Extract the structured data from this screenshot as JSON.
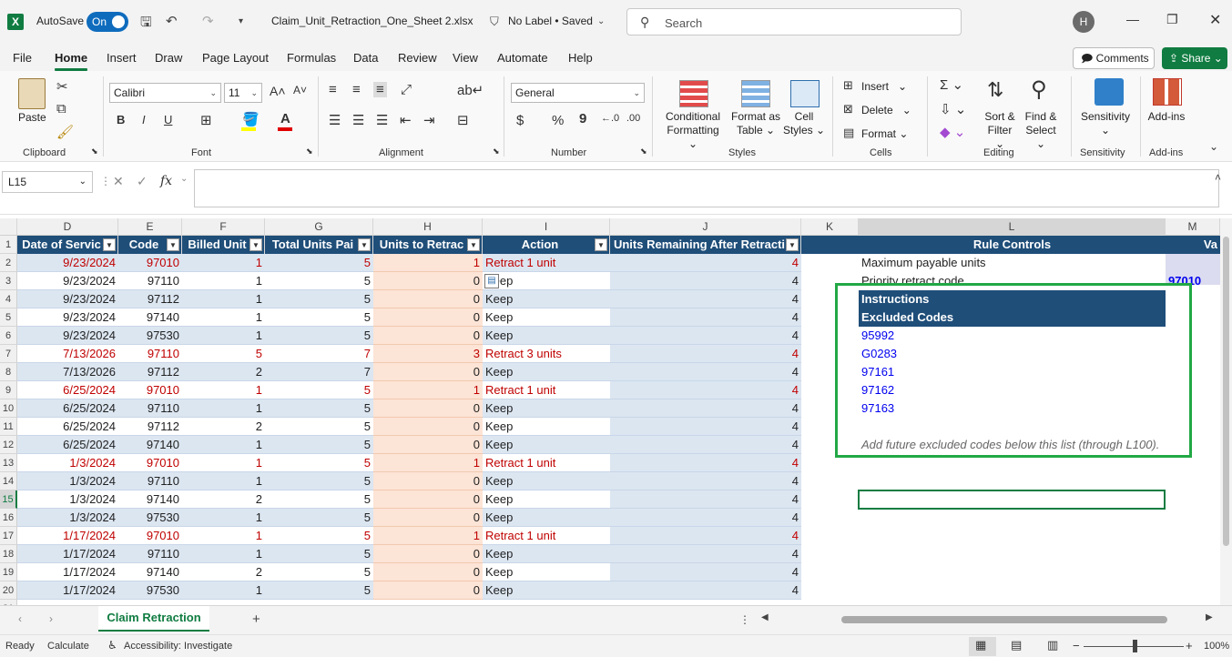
{
  "titlebar": {
    "autosave_label": "AutoSave",
    "autosave_state": "On",
    "filename": "Claim_Unit_Retraction_One_Sheet 2.xlsx",
    "label_status": "No Label • Saved",
    "search_placeholder": "Search",
    "user_initial": "H"
  },
  "menu": {
    "items": [
      "File",
      "Home",
      "Insert",
      "Draw",
      "Page Layout",
      "Formulas",
      "Data",
      "Review",
      "View",
      "Automate",
      "Help"
    ],
    "active": "Home",
    "comments": "Comments",
    "share": "Share"
  },
  "ribbon": {
    "clipboard": {
      "paste": "Paste",
      "label": "Clipboard"
    },
    "font": {
      "name": "Calibri",
      "size": "11",
      "label": "Font",
      "bold": "B",
      "italic": "I",
      "underline": "U"
    },
    "alignment": {
      "label": "Alignment"
    },
    "number": {
      "format": "General",
      "label": "Number",
      "currency": "$",
      "percent": "%",
      "comma": "9"
    },
    "styles": {
      "conditional": "Conditional",
      "formatting": "Formatting",
      "format_as": "Format as",
      "table": "Table",
      "cell": "Cell",
      "cell_styles": "Styles",
      "label": "Styles"
    },
    "cells": {
      "insert": "Insert",
      "delete": "Delete",
      "format": "Format",
      "label": "Cells"
    },
    "editing": {
      "sort": "Sort &",
      "filter": "Filter",
      "find": "Find &",
      "select": "Select",
      "label": "Editing"
    },
    "sensitivity": {
      "btn": "Sensitivity",
      "label": "Sensitivity"
    },
    "addins": {
      "btn": "Add-ins",
      "label": "Add-ins"
    }
  },
  "formula": {
    "namebox": "L15",
    "fx": "fx"
  },
  "grid": {
    "columns": [
      {
        "letter": "D",
        "width": 111
      },
      {
        "letter": "E",
        "width": 70
      },
      {
        "letter": "F",
        "width": 91
      },
      {
        "letter": "G",
        "width": 119
      },
      {
        "letter": "H",
        "width": 120
      },
      {
        "letter": "I",
        "width": 140
      },
      {
        "letter": "J",
        "width": 210
      },
      {
        "letter": "K",
        "width": 63
      },
      {
        "letter": "L",
        "width": 337
      },
      {
        "letter": "M",
        "width": 60
      }
    ],
    "headers": [
      "Date of Servic",
      "Code",
      "Billed Unit",
      "Total Units Pai",
      "Units to Retrac",
      "Action",
      "Units Remaining After Retracti"
    ],
    "rows": [
      {
        "date": "9/23/2024",
        "code": "97010",
        "billed": "1",
        "total": "5",
        "retract": "1",
        "action": "Retract 1 unit",
        "remaining": "4",
        "red": true
      },
      {
        "date": "9/23/2024",
        "code": "97110",
        "billed": "1",
        "total": "5",
        "retract": "0",
        "action": "Keep",
        "remaining": "4",
        "red": false
      },
      {
        "date": "9/23/2024",
        "code": "97112",
        "billed": "1",
        "total": "5",
        "retract": "0",
        "action": "Keep",
        "remaining": "4",
        "red": false
      },
      {
        "date": "9/23/2024",
        "code": "97140",
        "billed": "1",
        "total": "5",
        "retract": "0",
        "action": "Keep",
        "remaining": "4",
        "red": false
      },
      {
        "date": "9/23/2024",
        "code": "97530",
        "billed": "1",
        "total": "5",
        "retract": "0",
        "action": "Keep",
        "remaining": "4",
        "red": false
      },
      {
        "date": "7/13/2026",
        "code": "97110",
        "billed": "5",
        "total": "7",
        "retract": "3",
        "action": "Retract 3 units",
        "remaining": "4",
        "red": true
      },
      {
        "date": "7/13/2026",
        "code": "97112",
        "billed": "2",
        "total": "7",
        "retract": "0",
        "action": "Keep",
        "remaining": "4",
        "red": false
      },
      {
        "date": "6/25/2024",
        "code": "97010",
        "billed": "1",
        "total": "5",
        "retract": "1",
        "action": "Retract 1 unit",
        "remaining": "4",
        "red": true
      },
      {
        "date": "6/25/2024",
        "code": "97110",
        "billed": "1",
        "total": "5",
        "retract": "0",
        "action": "Keep",
        "remaining": "4",
        "red": false
      },
      {
        "date": "6/25/2024",
        "code": "97112",
        "billed": "2",
        "total": "5",
        "retract": "0",
        "action": "Keep",
        "remaining": "4",
        "red": false
      },
      {
        "date": "6/25/2024",
        "code": "97140",
        "billed": "1",
        "total": "5",
        "retract": "0",
        "action": "Keep",
        "remaining": "4",
        "red": false
      },
      {
        "date": "1/3/2024",
        "code": "97010",
        "billed": "1",
        "total": "5",
        "retract": "1",
        "action": "Retract 1 unit",
        "remaining": "4",
        "red": true
      },
      {
        "date": "1/3/2024",
        "code": "97110",
        "billed": "1",
        "total": "5",
        "retract": "0",
        "action": "Keep",
        "remaining": "4",
        "red": false
      },
      {
        "date": "1/3/2024",
        "code": "97140",
        "billed": "2",
        "total": "5",
        "retract": "0",
        "action": "Keep",
        "remaining": "4",
        "red": false
      },
      {
        "date": "1/3/2024",
        "code": "97530",
        "billed": "1",
        "total": "5",
        "retract": "0",
        "action": "Keep",
        "remaining": "4",
        "red": false
      },
      {
        "date": "1/17/2024",
        "code": "97010",
        "billed": "1",
        "total": "5",
        "retract": "1",
        "action": "Retract 1 unit",
        "remaining": "4",
        "red": true
      },
      {
        "date": "1/17/2024",
        "code": "97110",
        "billed": "1",
        "total": "5",
        "retract": "0",
        "action": "Keep",
        "remaining": "4",
        "red": false
      },
      {
        "date": "1/17/2024",
        "code": "97140",
        "billed": "2",
        "total": "5",
        "retract": "0",
        "action": "Keep",
        "remaining": "4",
        "red": false
      },
      {
        "date": "1/17/2024",
        "code": "97530",
        "billed": "1",
        "total": "5",
        "retract": "0",
        "action": "Keep",
        "remaining": "4",
        "red": false
      }
    ],
    "rule_controls": {
      "header": "Rule Controls",
      "next_header": "Va",
      "max_units": "Maximum payable units",
      "priority": "Priority retract code",
      "priority_value": "97010",
      "instructions": "Instructions",
      "excluded": "Excluded Codes",
      "codes": [
        "95992",
        "G0283",
        "97161",
        "97162",
        "97163"
      ],
      "note": "Add future excluded codes below this list (through L100)."
    }
  },
  "sheet": {
    "tab": "Claim Retraction",
    "add": "+"
  },
  "status": {
    "ready": "Ready",
    "calculate": "Calculate",
    "accessibility": "Accessibility: Investigate",
    "zoom": "100%"
  },
  "colors": {
    "header_blue": "#1f4e79",
    "row_blue": "#dce6f1",
    "retract_peach": "#fce4d6",
    "red_text": "#c00000",
    "highlight_green": "#22a845",
    "excel_green": "#107c41"
  }
}
